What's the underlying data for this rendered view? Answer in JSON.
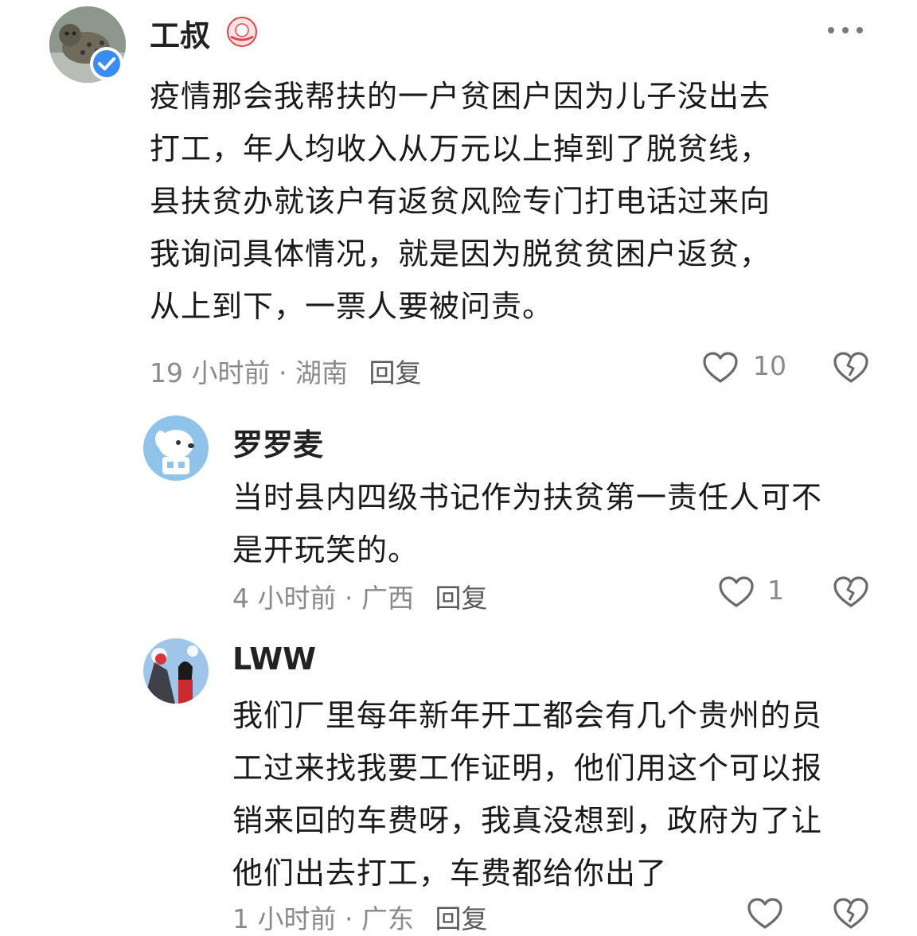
{
  "comments": [
    {
      "author": "工叔",
      "avatar_icon": "leopard-avatar",
      "verified_icon": "verified-badge-icon",
      "badge_icon": "fan-badge-icon",
      "more_icon": "more-options-icon",
      "lines": [
        "疫情那会我帮扶的一户贫困户因为儿子没出去",
        "打工，年人均收入从万元以上掉到了脱贫线，",
        "县扶贫办就该户有返贫风险专门打电话过来向",
        "我询问具体情况，就是因为脱贫贫困户返贫，",
        "从上到下，一票人要被问责。"
      ],
      "time": "19 小时前",
      "location": "湖南",
      "reply": "回复",
      "likes": "10"
    },
    {
      "author": "罗罗麦",
      "avatar_icon": "dog-avatar",
      "lines": [
        "当时县内四级书记作为扶贫第一责任人可不",
        "是开玩笑的。"
      ],
      "time": "4 小时前",
      "location": "广西",
      "reply": "回复",
      "likes": "1"
    },
    {
      "author": "LWW",
      "avatar_icon": "anime-avatar",
      "lines": [
        "我们厂里每年新年开工都会有几个贵州的员",
        "工过来找我要工作证明，他们用这个可以报",
        "销来回的车费呀，我真没想到，政府为了让",
        "他们出去打工，车费都给你出了"
      ],
      "time": "1 小时前",
      "location": "广东",
      "reply": "回复",
      "likes": ""
    }
  ],
  "separator": "·",
  "icons": {
    "like": "heart-outline-icon",
    "dislike": "broken-heart-icon"
  },
  "colors": {
    "text": "#1a1a1a",
    "meta": "#8a8a8a",
    "verified": "#3b8cf0"
  }
}
